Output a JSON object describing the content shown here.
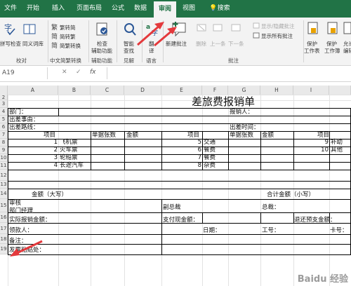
{
  "menu": {
    "tabs": [
      "文件",
      "开始",
      "插入",
      "页面布局",
      "公式",
      "数据",
      "审阅",
      "视图",
      "搜索"
    ],
    "active": "审阅"
  },
  "ribbon": {
    "proofing": {
      "spell": "拼写检查",
      "thesaurus": "同义词库",
      "label": "校对"
    },
    "chinese": {
      "t2s": "繁转简",
      "s2t": "简转繁",
      "convert": "简繁转换",
      "label": "中文简繁转换"
    },
    "access": {
      "check": "检查",
      "check2": "辅助功能",
      "label": "辅助功能"
    },
    "insights": {
      "smart": "智能",
      "smart2": "查找",
      "label": "见解"
    },
    "language": {
      "translate": "翻",
      "translate2": "译",
      "label": "语言"
    },
    "comments": {
      "new": "新建批注",
      "delete": "删除",
      "prev": "上一条",
      "next": "下一条",
      "show_hide": "显示/隐藏批注",
      "show_all": "显示所有批注",
      "label": "批注"
    },
    "protect": {
      "sheet": "保护",
      "sheet2": "工作表",
      "book": "保护",
      "book2": "工作簿",
      "allow": "允许",
      "allow2": "编辑"
    }
  },
  "formula_bar": {
    "cell_ref": "A19",
    "fx": "fx",
    "cancel": "✕",
    "confirm": "✓"
  },
  "columns": [
    "A",
    "B",
    "C",
    "D",
    "E",
    "F",
    "G",
    "H",
    "I"
  ],
  "rows": [
    "2",
    "3",
    "4",
    "5",
    "6",
    "7",
    "8",
    "9",
    "10",
    "11",
    "12",
    "13",
    "14",
    "15",
    "16",
    "17",
    "18",
    "19"
  ],
  "sheet": {
    "title": "差旅费报销单",
    "dept": "部门：",
    "reporter": "报销人：",
    "purpose": "出差事由：",
    "route": "出差路线：",
    "trip_time": "出差时间：",
    "item": "项目",
    "doc_count": "单据张数",
    "amount": "金额",
    "item2": "项目",
    "doc_count2": "单据张数",
    "amount2": "金额",
    "item3": "项目",
    "left_items": [
      {
        "no": "1",
        "name": "飞机票"
      },
      {
        "no": "2",
        "name": "火车票"
      },
      {
        "no": "3",
        "name": "轮船票"
      },
      {
        "no": "4",
        "name": "长途汽车"
      }
    ],
    "mid_items": [
      {
        "no": "5",
        "name": "交通"
      },
      {
        "no": "6",
        "name": "餐费"
      },
      {
        "no": "7",
        "name": "餐费"
      },
      {
        "no": "8",
        "name": "杂费"
      }
    ],
    "right_items": [
      {
        "no": "9",
        "name": "补助"
      },
      {
        "no": "10",
        "name": "其他"
      }
    ],
    "amount_cap": "金额（大写）",
    "total_small": "合计金额（小写）",
    "review": "审核",
    "dept_mgr": "部门经理",
    "vice_gm": "副总裁",
    "gm": "总裁：",
    "actual": "实际报销金额：",
    "cash_paid": "支付现金额：",
    "return_adv": "退还预支金额：",
    "receiver": "领款人：",
    "date": "日期：",
    "job_no": "工号：",
    "card_no": "卡号：",
    "note": "备注：",
    "receipt": "发票粘贴处："
  },
  "watermark": "Baidu 经验",
  "colors": {
    "brand": "#217346",
    "arrow": "#e4393c"
  }
}
